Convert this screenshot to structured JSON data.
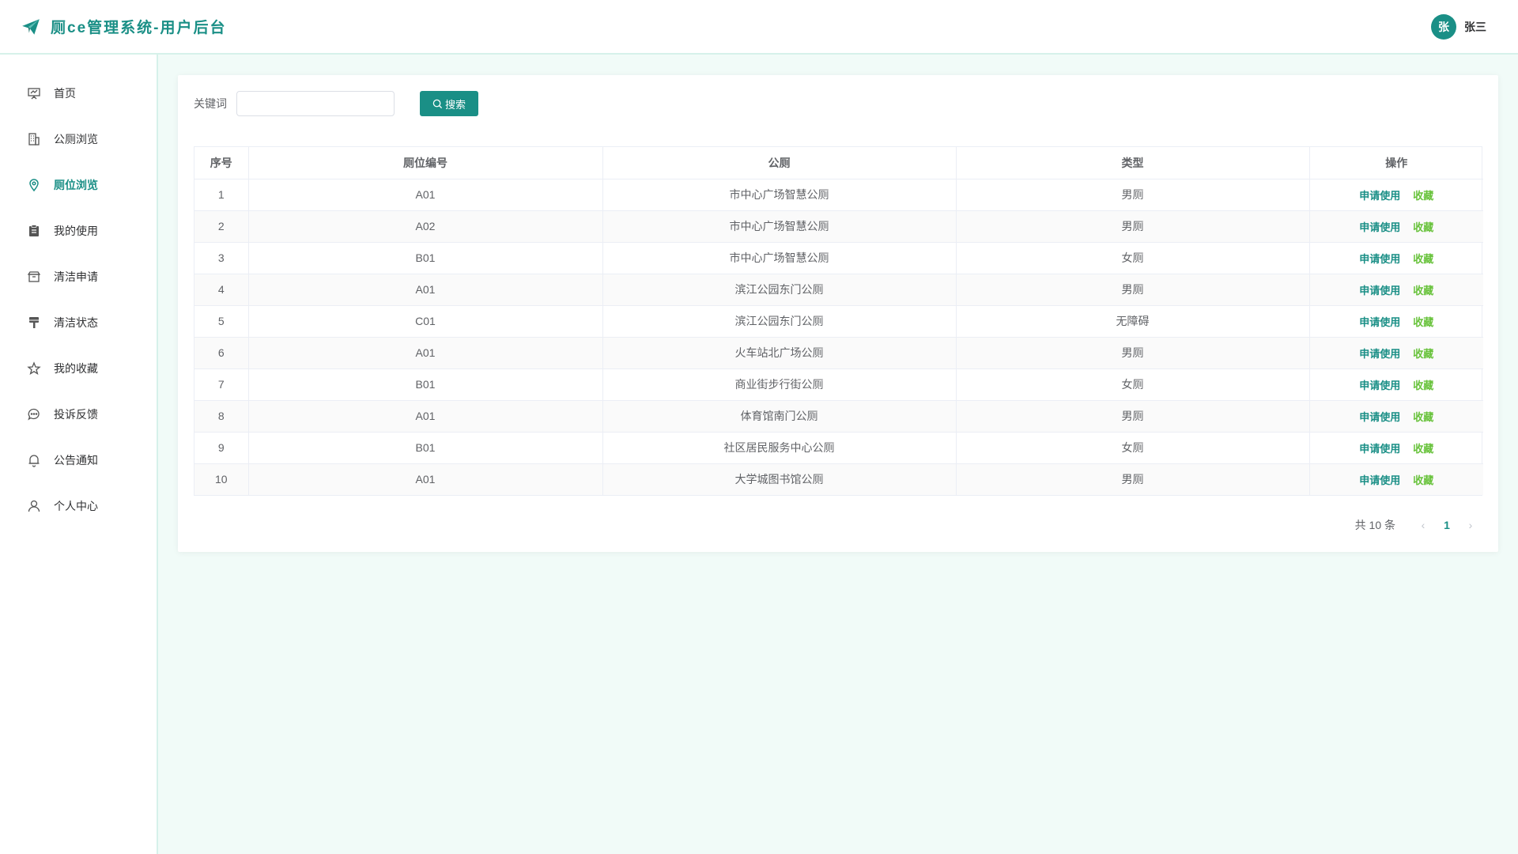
{
  "header": {
    "title": "厕ce管理系统-用户后台",
    "avatar_text": "张",
    "username": "张三"
  },
  "sidebar": {
    "items": [
      {
        "label": "首页",
        "icon": "presentation-icon",
        "active": false
      },
      {
        "label": "公厕浏览",
        "icon": "building-icon",
        "active": false
      },
      {
        "label": "厕位浏览",
        "icon": "location-pin-icon",
        "active": true
      },
      {
        "label": "我的使用",
        "icon": "clipboard-icon",
        "active": false
      },
      {
        "label": "清洁申请",
        "icon": "box-icon",
        "active": false
      },
      {
        "label": "清洁状态",
        "icon": "brush-icon",
        "active": false
      },
      {
        "label": "我的收藏",
        "icon": "star-icon",
        "active": false
      },
      {
        "label": "投诉反馈",
        "icon": "chat-bubble-icon",
        "active": false
      },
      {
        "label": "公告通知",
        "icon": "bell-icon",
        "active": false
      },
      {
        "label": "个人中心",
        "icon": "user-icon",
        "active": false
      }
    ]
  },
  "search": {
    "label": "关键词",
    "value": "",
    "placeholder": "",
    "button_label": "搜索"
  },
  "table": {
    "columns": [
      "序号",
      "厕位编号",
      "公厕",
      "类型",
      "操作"
    ],
    "action_apply": "申请使用",
    "action_fav": "收藏",
    "rows": [
      [
        "1",
        "A01",
        "市中心广场智慧公厕",
        "男厕"
      ],
      [
        "2",
        "A02",
        "市中心广场智慧公厕",
        "男厕"
      ],
      [
        "3",
        "B01",
        "市中心广场智慧公厕",
        "女厕"
      ],
      [
        "4",
        "A01",
        "滨江公园东门公厕",
        "男厕"
      ],
      [
        "5",
        "C01",
        "滨江公园东门公厕",
        "无障碍"
      ],
      [
        "6",
        "A01",
        "火车站北广场公厕",
        "男厕"
      ],
      [
        "7",
        "B01",
        "商业街步行街公厕",
        "女厕"
      ],
      [
        "8",
        "A01",
        "体育馆南门公厕",
        "男厕"
      ],
      [
        "9",
        "B01",
        "社区居民服务中心公厕",
        "女厕"
      ],
      [
        "10",
        "A01",
        "大学城图书馆公厕",
        "男厕"
      ]
    ]
  },
  "pagination": {
    "total_text": "共 10 条",
    "current_page": "1",
    "prev_symbol": "‹",
    "next_symbol": "›"
  },
  "colors": {
    "brand": "#1a8f86",
    "favorite": "#67c23a",
    "background": "#f1fbf8"
  }
}
